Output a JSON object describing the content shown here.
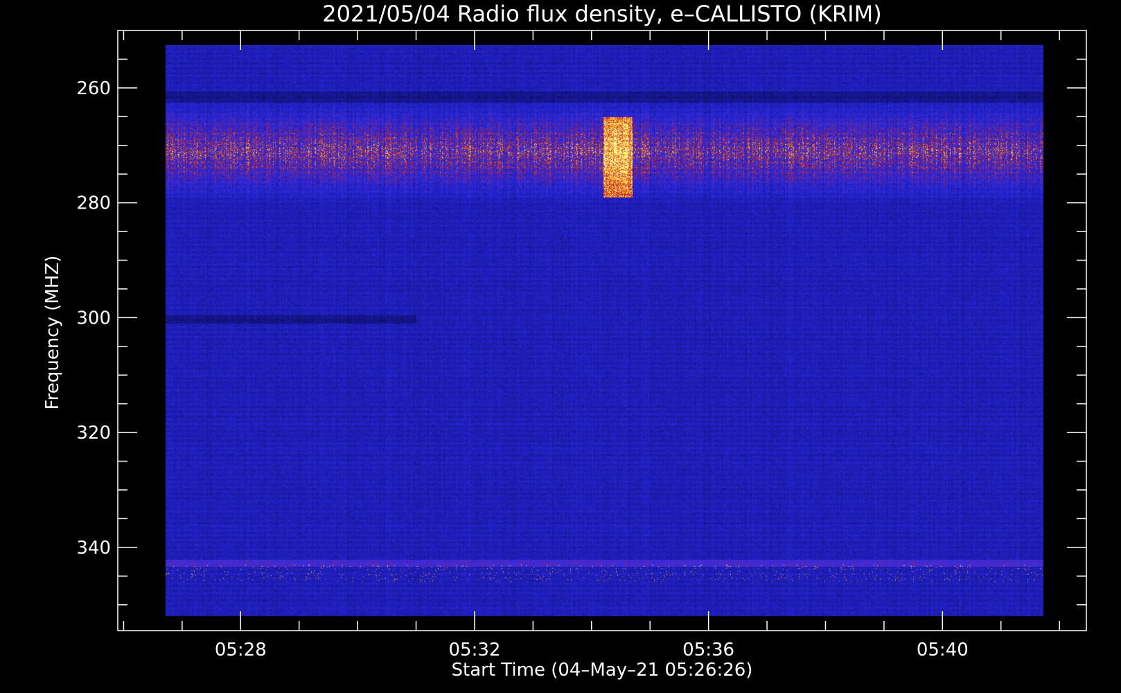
{
  "chart_data": {
    "type": "heatmap",
    "title": "2021/05/04  Radio flux density, e–CALLISTO (KRIM)",
    "xlabel": "Start Time (04–May–21 05:26:26)",
    "ylabel": "Frequency (MHZ)",
    "x_ticks": [
      "05:28",
      "05:32",
      "05:36",
      "05:40"
    ],
    "x_tick_minutes": [
      28,
      32,
      36,
      40
    ],
    "y_ticks": [
      260,
      280,
      300,
      320,
      340
    ],
    "xlim_minutes": [
      25.9,
      42.46
    ],
    "ylim": [
      250,
      354.5
    ],
    "data_extent": {
      "time_minutes": [
        26.72,
        41.73
      ],
      "freq_mhz": [
        252.5,
        352
      ]
    },
    "colormap": [
      "#0c0c52",
      "#1c1cb4",
      "#3030ee",
      "#c81420",
      "#ff8c00",
      "#ffffa0"
    ],
    "features": [
      {
        "kind": "band",
        "freq_mhz": [
          266,
          276
        ],
        "intensity": "high"
      },
      {
        "kind": "burst",
        "time_minutes": [
          34.2,
          34.7
        ],
        "freq_mhz": [
          265,
          279
        ],
        "intensity": "very high"
      },
      {
        "kind": "band",
        "freq_mhz": [
          343,
          346
        ],
        "intensity": "medium"
      }
    ]
  }
}
